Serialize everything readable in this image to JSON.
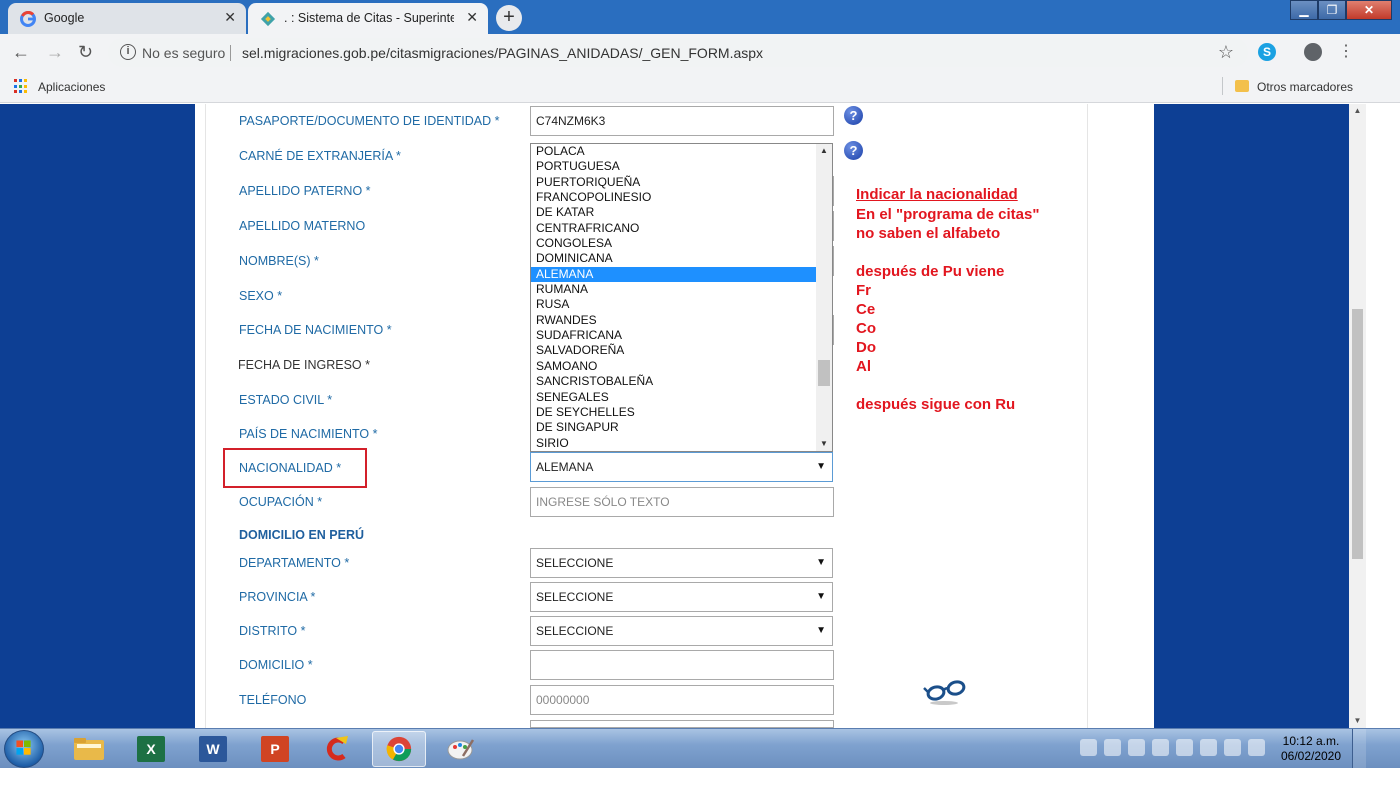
{
  "browser": {
    "tabs": [
      {
        "title": "Google",
        "favicon": "google-g-icon"
      },
      {
        "title": ". : Sistema de Citas - Superintendencia",
        "favicon": "migraciones-diamond-icon"
      }
    ],
    "new_tab_label": "+",
    "security_label": "No es seguro",
    "url": "sel.migraciones.gob.pe/citasmigraciones/PAGINAS_ANIDADAS/_GEN_FORM.aspx",
    "bookmarks": {
      "apps_label": "Aplicaciones",
      "other_label": "Otros marcadores"
    }
  },
  "form": {
    "labels": {
      "pasaporte": "PASAPORTE/DOCUMENTO DE IDENTIDAD  *",
      "carne": "CARNÉ DE EXTRANJERÍA *",
      "apellido_paterno": "APELLIDO PATERNO  *",
      "apellido_materno": "APELLIDO MATERNO",
      "nombres": "NOMBRE(S)  *",
      "sexo": "SEXO  *",
      "fecha_nacimiento": "FECHA DE NACIMIENTO  *",
      "fecha_ingreso": "FECHA DE INGRESO   *",
      "estado_civil": "ESTADO CIVIL  *",
      "pais_nacimiento": "PAÍS DE NACIMIENTO  *",
      "nacionalidad": "NACIONALIDAD  *",
      "ocupacion": "OCUPACIÓN  *",
      "domicilio_section": "DOMICILIO EN PERÚ",
      "departamento": "DEPARTAMENTO  *",
      "provincia": "PROVINCIA  *",
      "distrito": "DISTRITO  *",
      "domicilio": "DOMICILIO  *",
      "telefono": "TELÉFONO"
    },
    "values": {
      "pasaporte": "C74NZM6K3",
      "nacionalidad": "ALEMANA",
      "ocupacion_placeholder": "INGRESE SÓLO TEXTO",
      "departamento": "SELECCIONE",
      "provincia": "SELECCIONE",
      "distrito": "SELECCIONE",
      "domicilio": "",
      "telefono": "00000000"
    },
    "help_icon_glyph": "?",
    "nacionalidad_options": [
      "POLACA",
      "PORTUGUESA",
      "PUERTORIQUEÑA",
      "FRANCOPOLINESIO",
      "DE KATAR",
      "CENTRAFRICANO",
      "CONGOLESA",
      "DOMINICANA",
      "ALEMANA",
      "RUMANA",
      "RUSA",
      "RWANDES",
      "SUDAFRICANA",
      "SALVADOREÑA",
      "SAMOANO",
      "SANCRISTOBALEÑA",
      "SENEGALES",
      "DE SEYCHELLES",
      "DE SINGAPUR",
      "SIRIO"
    ],
    "selected_option": "ALEMANA"
  },
  "annotation": {
    "lines": [
      {
        "text": "Indicar la nacionalidad",
        "underline": true
      },
      {
        "text": "En el \"programa de citas\"",
        "underline": false
      },
      {
        "text": "no saben el alfabeto",
        "underline": false
      },
      {
        "text": "después de Pu viene",
        "underline": false
      },
      {
        "text": "Fr",
        "underline": false
      },
      {
        "text": "Ce",
        "underline": false
      },
      {
        "text": "Co",
        "underline": false
      },
      {
        "text": "Do",
        "underline": false
      },
      {
        "text": "Al",
        "underline": false
      },
      {
        "text": "después sigue con Ru",
        "underline": false
      }
    ],
    "color": "#e2161f",
    "highlight_color": "#d3202a"
  },
  "taskbar": {
    "apps": [
      {
        "name": "explorer",
        "icon": "folder-icon"
      },
      {
        "name": "excel",
        "icon": "excel-icon",
        "glyph": "X"
      },
      {
        "name": "word",
        "icon": "word-icon",
        "glyph": "W"
      },
      {
        "name": "powerpoint",
        "icon": "powerpoint-icon",
        "glyph": "P"
      },
      {
        "name": "ccleaner",
        "icon": "ccleaner-icon"
      },
      {
        "name": "chrome",
        "icon": "chrome-icon"
      },
      {
        "name": "paint",
        "icon": "paint-icon"
      }
    ],
    "clock": {
      "time": "10:12 a.m.",
      "date": "06/02/2020"
    }
  }
}
